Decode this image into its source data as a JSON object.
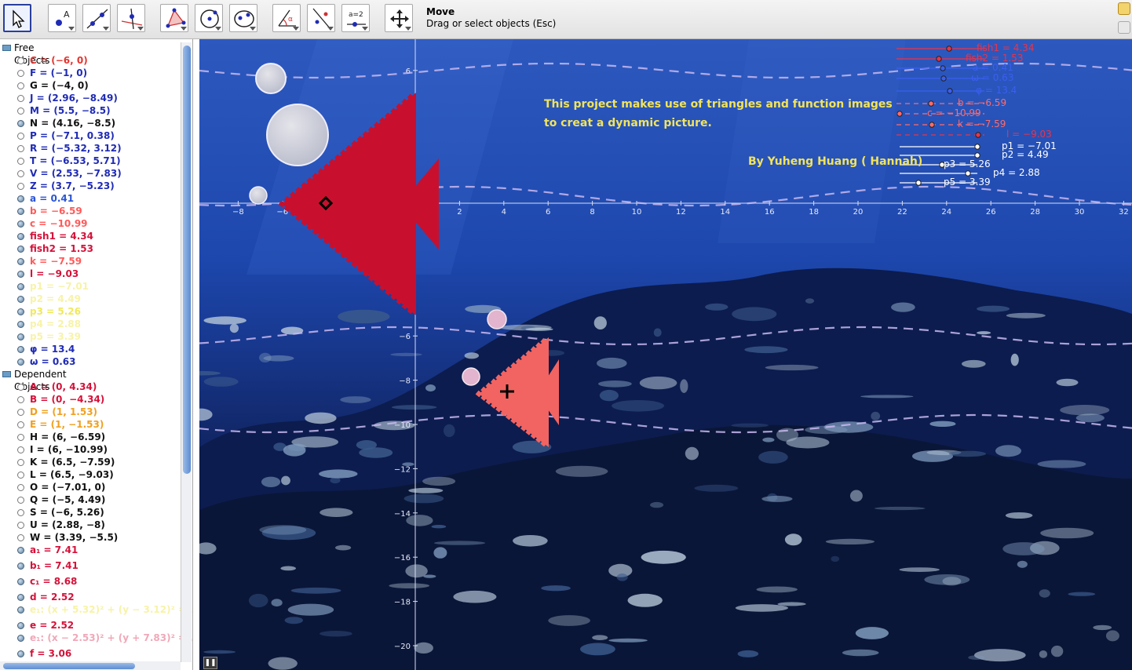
{
  "toolbar": {
    "tools": [
      {
        "name": "move-tool",
        "icon": "cursor-arrow-icon"
      },
      {
        "name": "point-tool",
        "icon": "point-icon"
      },
      {
        "name": "line-tool",
        "icon": "line-through-points-icon"
      },
      {
        "name": "perpendicular-tool",
        "icon": "perpendicular-line-icon"
      },
      {
        "name": "polygon-tool",
        "icon": "polygon-icon"
      },
      {
        "name": "circle-tool",
        "icon": "circle-center-point-icon"
      },
      {
        "name": "ellipse-tool",
        "icon": "ellipse-icon"
      },
      {
        "name": "angle-tool",
        "icon": "angle-icon"
      },
      {
        "name": "reflect-tool",
        "icon": "reflect-line-icon"
      },
      {
        "name": "slider-tool",
        "icon": "slider-icon"
      },
      {
        "name": "move-view-tool",
        "icon": "move-graphics-view-icon"
      }
    ],
    "slider_icon_text": "a=2",
    "active_tool_title": "Move",
    "active_tool_help": "Drag or select objects (Esc)"
  },
  "algebra": {
    "free_header": "Free Objects",
    "dependent_header": "Dependent Objects",
    "free": [
      {
        "text": "C = (−6, 0)",
        "color": "#e3342f",
        "filled": false
      },
      {
        "text": "F = (−1, 0)",
        "color": "#1f2bb5",
        "filled": false
      },
      {
        "text": "G = (−4, 0)",
        "color": "#111111",
        "filled": false
      },
      {
        "text": "J = (2.96, −8.49)",
        "color": "#1f2bb5",
        "filled": false
      },
      {
        "text": "M = (5.5, −8.5)",
        "color": "#1f2bb5",
        "filled": false
      },
      {
        "text": "N = (4.16, −8.5)",
        "color": "#111111",
        "filled": true
      },
      {
        "text": "P = (−7.1, 0.38)",
        "color": "#1f2bb5",
        "filled": false
      },
      {
        "text": "R = (−5.32, 3.12)",
        "color": "#1f2bb5",
        "filled": false
      },
      {
        "text": "T = (−6.53, 5.71)",
        "color": "#1f2bb5",
        "filled": false
      },
      {
        "text": "V = (2.53, −7.83)",
        "color": "#1f2bb5",
        "filled": false
      },
      {
        "text": "Z = (3.7, −5.23)",
        "color": "#1f2bb5",
        "filled": false
      },
      {
        "text": "a = 0.41",
        "color": "#2a55d6",
        "filled": true
      },
      {
        "text": "b = −6.59",
        "color": "#ff5a5a",
        "filled": true
      },
      {
        "text": "c = −10.99",
        "color": "#ff5a5a",
        "filled": true
      },
      {
        "text": "fish1 = 4.34",
        "color": "#d4123a",
        "filled": true
      },
      {
        "text": "fish2 = 1.53",
        "color": "#d4123a",
        "filled": true
      },
      {
        "text": "k = −7.59",
        "color": "#ff5a5a",
        "filled": true
      },
      {
        "text": "l = −9.03",
        "color": "#d4123a",
        "filled": true
      },
      {
        "text": "p1 = −7.01",
        "color": "#f7f3a8",
        "filled": true
      },
      {
        "text": "p2 = 4.49",
        "color": "#f7f3a8",
        "filled": true
      },
      {
        "text": "p3 = 5.26",
        "color": "#f0e85e",
        "filled": true
      },
      {
        "text": "p4 = 2.88",
        "color": "#f7f3a8",
        "filled": true
      },
      {
        "text": "p5 = 3.39",
        "color": "#f7f3a8",
        "filled": true
      },
      {
        "text": "φ = 13.4",
        "color": "#1f2bb5",
        "filled": true
      },
      {
        "text": "ω = 0.63",
        "color": "#1f2bb5",
        "filled": true
      }
    ],
    "dependent": [
      {
        "text": "A = (0, 4.34)",
        "color": "#d4123a",
        "filled": false
      },
      {
        "text": "B = (0, −4.34)",
        "color": "#d4123a",
        "filled": false
      },
      {
        "text": "D = (1, 1.53)",
        "color": "#f0a020",
        "filled": false
      },
      {
        "text": "E = (1, −1.53)",
        "color": "#f0a020",
        "filled": false
      },
      {
        "text": "H = (6, −6.59)",
        "color": "#111111",
        "filled": false
      },
      {
        "text": "I = (6, −10.99)",
        "color": "#111111",
        "filled": false
      },
      {
        "text": "K = (6.5, −7.59)",
        "color": "#111111",
        "filled": false
      },
      {
        "text": "L = (6.5, −9.03)",
        "color": "#111111",
        "filled": false
      },
      {
        "text": "O = (−7.01, 0)",
        "color": "#111111",
        "filled": false
      },
      {
        "text": "Q = (−5, 4.49)",
        "color": "#111111",
        "filled": false
      },
      {
        "text": "S = (−6, 5.26)",
        "color": "#111111",
        "filled": false
      },
      {
        "text": "U = (2.88, −8)",
        "color": "#111111",
        "filled": false
      },
      {
        "text": "W = (3.39, −5.5)",
        "color": "#111111",
        "filled": false
      },
      {
        "text": "a₁ = 7.41",
        "color": "#d4123a",
        "filled": true
      },
      {
        "text": "b₁ = 7.41",
        "color": "#d4123a",
        "filled": true
      },
      {
        "text": "c₁ = 8.68",
        "color": "#d4123a",
        "filled": true
      },
      {
        "text": "d = 2.52",
        "color": "#d4123a",
        "filled": true
      },
      {
        "text": "e₁: (x + 5.32)² + (y − 3.12)² = …",
        "color": "#f7f3a8",
        "filled": true
      },
      {
        "text": "e = 2.52",
        "color": "#d4123a",
        "filled": true
      },
      {
        "text": "e₁: (x − 2.53)² + (y + 7.83)² = …",
        "color": "#f0a8b8",
        "filled": true
      },
      {
        "text": "f = 3.06",
        "color": "#d4123a",
        "filled": true
      }
    ]
  },
  "graphics": {
    "annotation_line1": "This project makes use of  triangles and function images",
    "annotation_line2": "to creat a dynamic picture.",
    "author": "By   Yuheng Huang ( Hannah)",
    "x_ticks": [
      "−8",
      "−6",
      "2",
      "4",
      "6",
      "8",
      "10",
      "12",
      "14",
      "16",
      "18",
      "20",
      "22",
      "24",
      "26",
      "28",
      "30",
      "32"
    ],
    "y_ticks": [
      "6",
      "−6",
      "−8",
      "−10",
      "−12",
      "−14",
      "−16",
      "−18",
      "−20"
    ],
    "sliders": [
      {
        "label": "fish1 = 4.34",
        "color": "#e8344a"
      },
      {
        "label": "fish2 = 1.53",
        "color": "#e8344a"
      },
      {
        "label": "a = 0.41",
        "color": "#3a5ff0"
      },
      {
        "label": "ω = 0.63",
        "color": "#3a5ff0"
      },
      {
        "label": "φ = 13.4",
        "color": "#3a5ff0"
      },
      {
        "label": "b = −6.59",
        "color": "#ff6b6b"
      },
      {
        "label": "c = −10.99",
        "color": "#ff6b6b"
      },
      {
        "label": "k = −7.59",
        "color": "#ff6b6b"
      },
      {
        "label": "l = −9.03",
        "color": "#e8344a"
      },
      {
        "label": "p1 = −7.01",
        "color": "#ffffff"
      },
      {
        "label": "p2 = 4.49",
        "color": "#ffffff"
      },
      {
        "label": "p3 = 5.26",
        "color": "#ffffff"
      },
      {
        "label": "p4 = 2.88",
        "color": "#ffffff"
      },
      {
        "label": "p5 = 3.39",
        "color": "#ffffff"
      }
    ],
    "colors": {
      "big_fish": "#c8102e",
      "small_fish": "#f26461",
      "wave": "#c8b8f0",
      "bubble": "#d8d6e0",
      "pink_bubble": "#e6b0c8"
    }
  }
}
